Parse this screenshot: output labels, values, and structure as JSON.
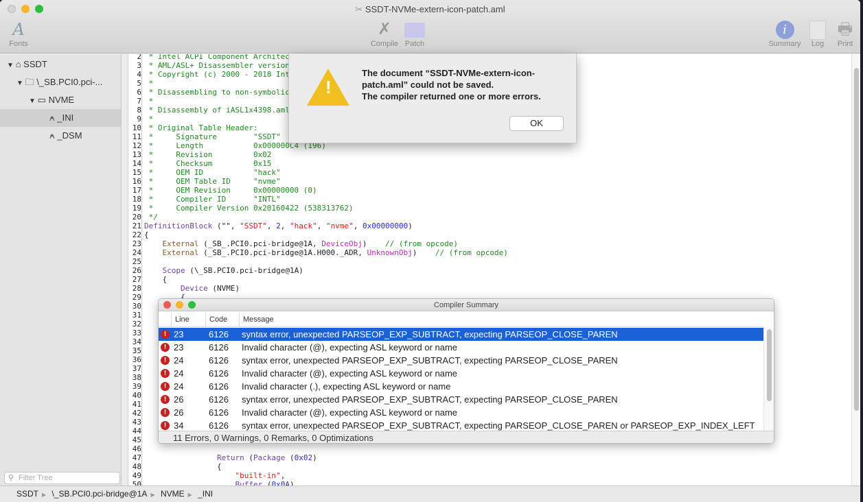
{
  "window": {
    "title": "SSDT-NVMe-extern-icon-patch.aml"
  },
  "toolbar": {
    "fonts": {
      "label": "Fonts",
      "icon": "font-icon"
    },
    "compile": {
      "label": "Compile",
      "icon": "tools-icon"
    },
    "patch": {
      "label": "Patch",
      "icon": "folder-gear-icon"
    },
    "summary": {
      "label": "Summary",
      "icon": "info-icon"
    },
    "log": {
      "label": "Log",
      "icon": "documents-icon"
    },
    "print": {
      "label": "Print",
      "icon": "printer-icon"
    }
  },
  "tree": {
    "items": [
      {
        "label": "SSDT",
        "icon": "home-icon"
      },
      {
        "label": "\\_SB.PCI0.pci-...",
        "icon": "folder-icon"
      },
      {
        "label": "NVME",
        "icon": "device-icon"
      },
      {
        "label": "_INI",
        "icon": "method-icon"
      },
      {
        "label": "_DSM",
        "icon": "method-icon"
      }
    ],
    "selected": "_INI",
    "filter_placeholder": "Filter Tree"
  },
  "breadcrumb": [
    "SSDT",
    "\\_SB.PCI0.pci-bridge@1A",
    "NVME",
    "_INI"
  ],
  "editor": {
    "lines": [
      {
        "n": "2",
        "seg": [
          [
            "c",
            " * Intel ACPI Component Architec"
          ]
        ]
      },
      {
        "n": "3",
        "seg": [
          [
            "c",
            " * AML/ASL+ Disassembler version"
          ]
        ]
      },
      {
        "n": "4",
        "seg": [
          [
            "c",
            " * Copyright (c) 2000 - 2018 Int"
          ]
        ]
      },
      {
        "n": "5",
        "seg": [
          [
            "c",
            " *"
          ]
        ]
      },
      {
        "n": "6",
        "seg": [
          [
            "c",
            " * Disassembling to non-symbolic"
          ]
        ]
      },
      {
        "n": "7",
        "seg": [
          [
            "c",
            " *"
          ]
        ]
      },
      {
        "n": "8",
        "seg": [
          [
            "c",
            " * Disassembly of iASL1x4398.aml"
          ]
        ]
      },
      {
        "n": "9",
        "seg": [
          [
            "c",
            " *"
          ]
        ]
      },
      {
        "n": "10",
        "seg": [
          [
            "c",
            " * Original Table Header:"
          ]
        ]
      },
      {
        "n": "11",
        "seg": [
          [
            "c",
            " *     Signature        \"SSDT\""
          ]
        ]
      },
      {
        "n": "12",
        "seg": [
          [
            "c",
            " *     Length           0x000000C4 (196)"
          ]
        ]
      },
      {
        "n": "13",
        "seg": [
          [
            "c",
            " *     Revision         0x02"
          ]
        ]
      },
      {
        "n": "14",
        "seg": [
          [
            "c",
            " *     Checksum         0x15"
          ]
        ]
      },
      {
        "n": "15",
        "seg": [
          [
            "c",
            " *     OEM ID           \"hack\""
          ]
        ]
      },
      {
        "n": "16",
        "seg": [
          [
            "c",
            " *     OEM Table ID     \"nvme\""
          ]
        ]
      },
      {
        "n": "17",
        "seg": [
          [
            "c",
            " *     OEM Revision     0x00000000 (0)"
          ]
        ]
      },
      {
        "n": "18",
        "seg": [
          [
            "c",
            " *     Compiler ID      \"INTL\""
          ]
        ]
      },
      {
        "n": "19",
        "seg": [
          [
            "c",
            " *     Compiler Version 0x20160422 (538313762)"
          ]
        ]
      },
      {
        "n": "20",
        "seg": [
          [
            "c",
            " */"
          ]
        ]
      },
      {
        "n": "21",
        "seg": [
          [
            "k",
            "DefinitionBlock"
          ],
          [
            "p",
            " (\"\", "
          ],
          [
            "s",
            "\"SSDT\""
          ],
          [
            "p",
            ", "
          ],
          [
            "n",
            "2"
          ],
          [
            "p",
            ", "
          ],
          [
            "s",
            "\"hack\""
          ],
          [
            "p",
            ", "
          ],
          [
            "s",
            "\"nvme\""
          ],
          [
            "p",
            ", "
          ],
          [
            "n",
            "0x00000000"
          ],
          [
            "p",
            ")"
          ]
        ]
      },
      {
        "n": "22",
        "seg": [
          [
            "p",
            "{"
          ]
        ]
      },
      {
        "n": "23",
        "seg": [
          [
            "p",
            "    "
          ],
          [
            "e",
            "External"
          ],
          [
            "p",
            " (_SB_.PCI0.pci-bridge@1A, "
          ],
          [
            "t",
            "DeviceObj"
          ],
          [
            "p",
            ")    "
          ],
          [
            "c",
            "// (from opcode)"
          ]
        ]
      },
      {
        "n": "24",
        "seg": [
          [
            "p",
            "    "
          ],
          [
            "e",
            "External"
          ],
          [
            "p",
            " (_SB_.PCI0.pci-bridge@1A.H000._ADR, "
          ],
          [
            "t",
            "UnknownObj"
          ],
          [
            "p",
            ")    "
          ],
          [
            "c",
            "// (from opcode)"
          ]
        ]
      },
      {
        "n": "25",
        "seg": []
      },
      {
        "n": "26",
        "seg": [
          [
            "p",
            "    "
          ],
          [
            "k",
            "Scope"
          ],
          [
            "p",
            " (\\_SB.PCI0.pci-bridge@1A)"
          ]
        ]
      },
      {
        "n": "27",
        "seg": [
          [
            "p",
            "    {"
          ]
        ]
      },
      {
        "n": "28",
        "seg": [
          [
            "p",
            "        "
          ],
          [
            "k",
            "Device"
          ],
          [
            "p",
            " (NVME)"
          ]
        ]
      },
      {
        "n": "29",
        "seg": [
          [
            "p",
            "        {"
          ]
        ]
      },
      {
        "n": "30",
        "seg": []
      },
      {
        "n": "31",
        "seg": []
      },
      {
        "n": "32",
        "seg": []
      },
      {
        "n": "33",
        "seg": []
      },
      {
        "n": "34",
        "seg": []
      },
      {
        "n": "35",
        "seg": []
      },
      {
        "n": "36",
        "seg": []
      },
      {
        "n": "37",
        "seg": []
      },
      {
        "n": "38",
        "seg": []
      },
      {
        "n": "39",
        "seg": []
      },
      {
        "n": "40",
        "seg": []
      },
      {
        "n": "41",
        "seg": []
      },
      {
        "n": "42",
        "seg": []
      },
      {
        "n": "43",
        "seg": []
      },
      {
        "n": "44",
        "seg": []
      },
      {
        "n": "45",
        "seg": []
      },
      {
        "n": "46",
        "seg": []
      },
      {
        "n": "47",
        "seg": [
          [
            "p",
            "                "
          ],
          [
            "k",
            "Return"
          ],
          [
            "p",
            " ("
          ],
          [
            "k",
            "Package"
          ],
          [
            "p",
            " ("
          ],
          [
            "n",
            "0x02"
          ],
          [
            "p",
            ")"
          ]
        ]
      },
      {
        "n": "48",
        "seg": [
          [
            "p",
            "                {"
          ]
        ]
      },
      {
        "n": "49",
        "seg": [
          [
            "p",
            "                    "
          ],
          [
            "s",
            "\"built-in\""
          ],
          [
            "p",
            ","
          ]
        ]
      },
      {
        "n": "50",
        "seg": [
          [
            "p",
            "                    "
          ],
          [
            "k",
            "Buffer"
          ],
          [
            "p",
            " ("
          ],
          [
            "n",
            "0x0A"
          ],
          [
            "p",
            ")"
          ]
        ]
      }
    ]
  },
  "alert": {
    "icon": "warning-icon",
    "message_line1": "The document “SSDT-NVMe-extern-icon-patch.aml” could not be saved.",
    "message_line2": "The compiler returned one or more errors.",
    "ok_label": "OK"
  },
  "summary": {
    "title": "Compiler Summary",
    "columns": [
      "Line",
      "Code",
      "Message"
    ],
    "rows": [
      {
        "line": "23",
        "code": "6126",
        "message": "syntax error, unexpected PARSEOP_EXP_SUBTRACT, expecting PARSEOP_CLOSE_PAREN"
      },
      {
        "line": "23",
        "code": "6126",
        "message": "Invalid character (@), expecting ASL keyword or name"
      },
      {
        "line": "24",
        "code": "6126",
        "message": "syntax error, unexpected PARSEOP_EXP_SUBTRACT, expecting PARSEOP_CLOSE_PAREN"
      },
      {
        "line": "24",
        "code": "6126",
        "message": "Invalid character (@), expecting ASL keyword or name"
      },
      {
        "line": "24",
        "code": "6126",
        "message": "Invalid character (.), expecting ASL keyword or name"
      },
      {
        "line": "26",
        "code": "6126",
        "message": "syntax error, unexpected PARSEOP_EXP_SUBTRACT, expecting PARSEOP_CLOSE_PAREN"
      },
      {
        "line": "26",
        "code": "6126",
        "message": "Invalid character (@), expecting ASL keyword or name"
      },
      {
        "line": "34",
        "code": "6126",
        "message": "syntax error, unexpected PARSEOP_EXP_SUBTRACT, expecting PARSEOP_CLOSE_PAREN or PARSEOP_EXP_INDEX_LEFT"
      }
    ],
    "selected_row": 0,
    "footer": "11 Errors, 0 Warnings, 0 Remarks, 0 Optimizations"
  },
  "colors": {
    "selection": "#1b61d6",
    "error": "#c8201e",
    "comment": "#1f8a1f",
    "keyword": "#6f42a6",
    "string": "#d0231f",
    "number": "#2b2bd0"
  }
}
